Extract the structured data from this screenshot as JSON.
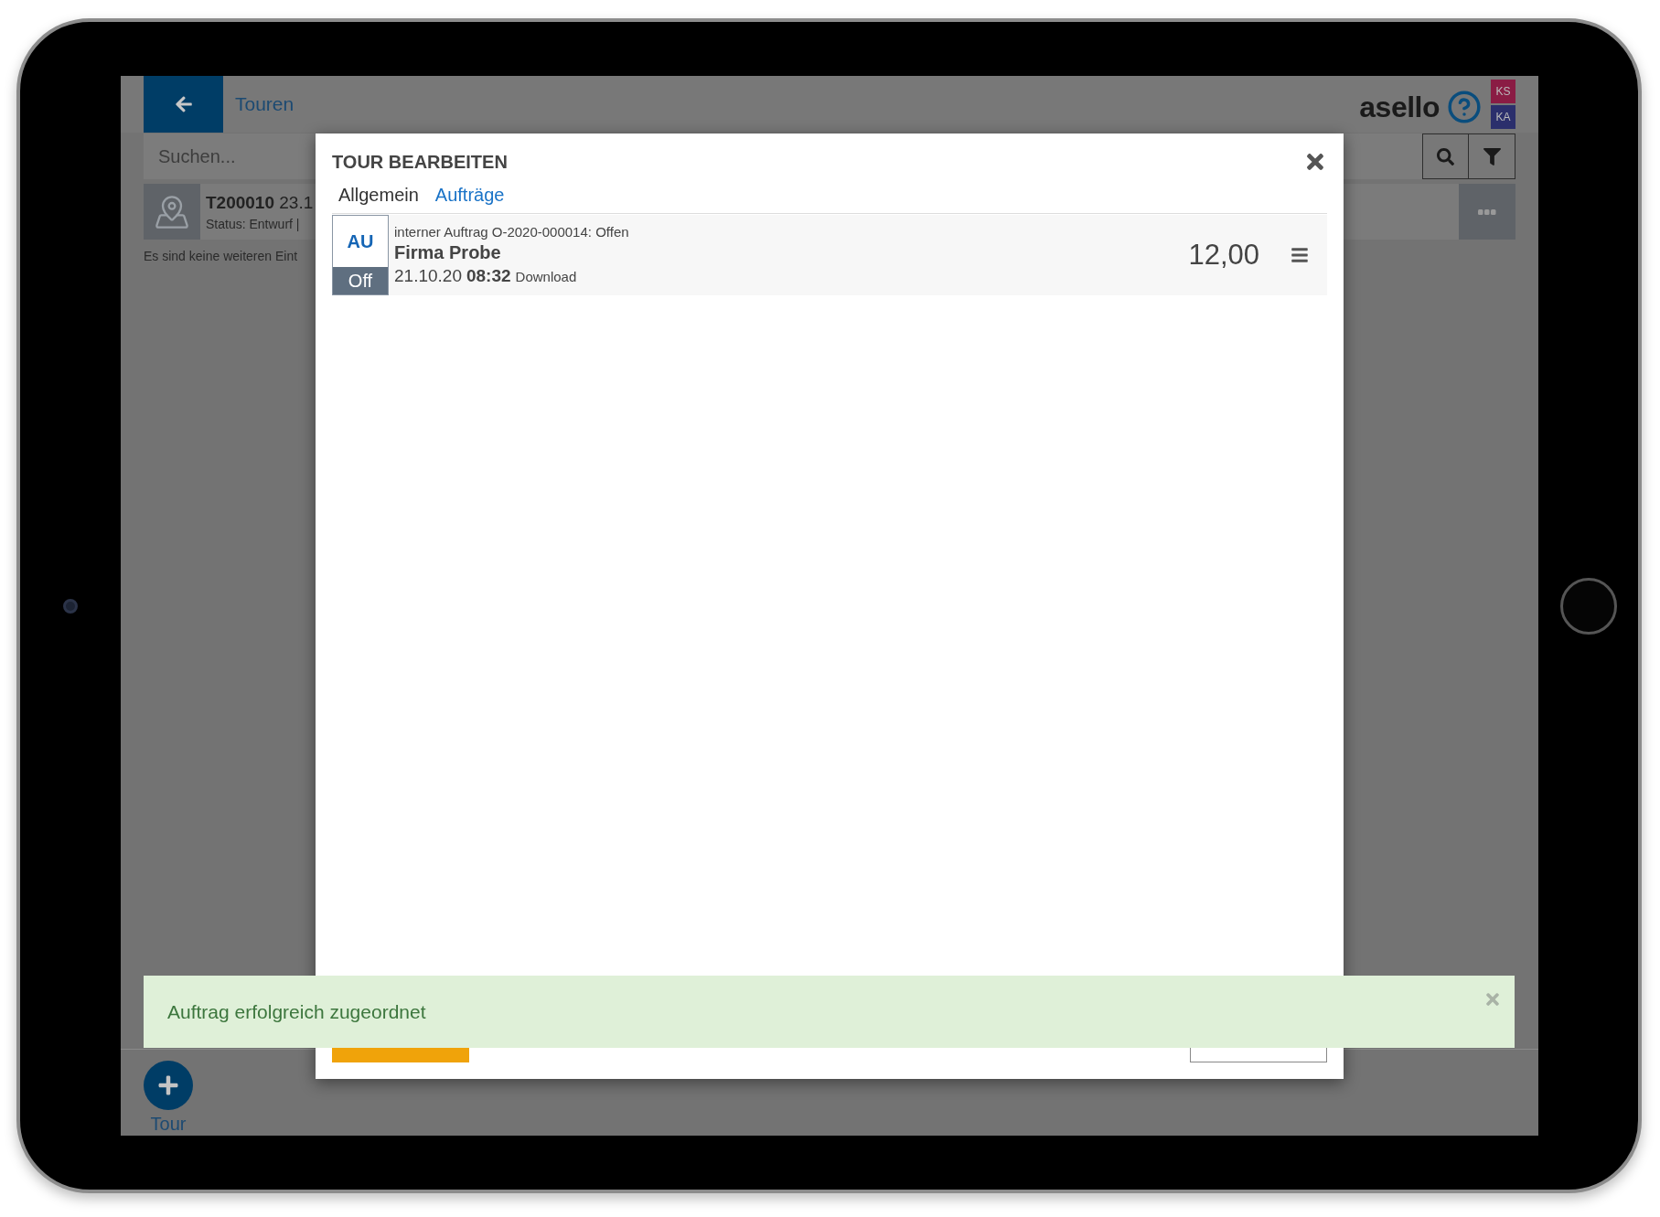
{
  "header": {
    "title": "Touren",
    "logo": "asello",
    "users": [
      {
        "initials": "KS",
        "color": "#8a1c44"
      },
      {
        "initials": "KA",
        "color": "#2b2f6c"
      }
    ]
  },
  "search": {
    "placeholder": "Suchen..."
  },
  "tours": [
    {
      "id": "T200010",
      "date": "23.1",
      "status": "Status: Entwurf |"
    }
  ],
  "list_note": "Es sind keine weiteren Eint",
  "dialog": {
    "title": "TOUR BEARBEITEN",
    "tabs": [
      {
        "label": "Allgemein",
        "selected": false
      },
      {
        "label": "Aufträge",
        "selected": true
      }
    ],
    "orders": [
      {
        "type": "AU",
        "state": "Off",
        "line": "interner Auftrag O-2020-000014: Offen",
        "customer": "Firma Probe",
        "date": "21.10.20",
        "time": "08:32",
        "status": "Download",
        "amount": "12,00"
      }
    ]
  },
  "toast": {
    "message": "Auftrag erfolgreich zugeordnet"
  },
  "fab": {
    "label": "Tour"
  }
}
